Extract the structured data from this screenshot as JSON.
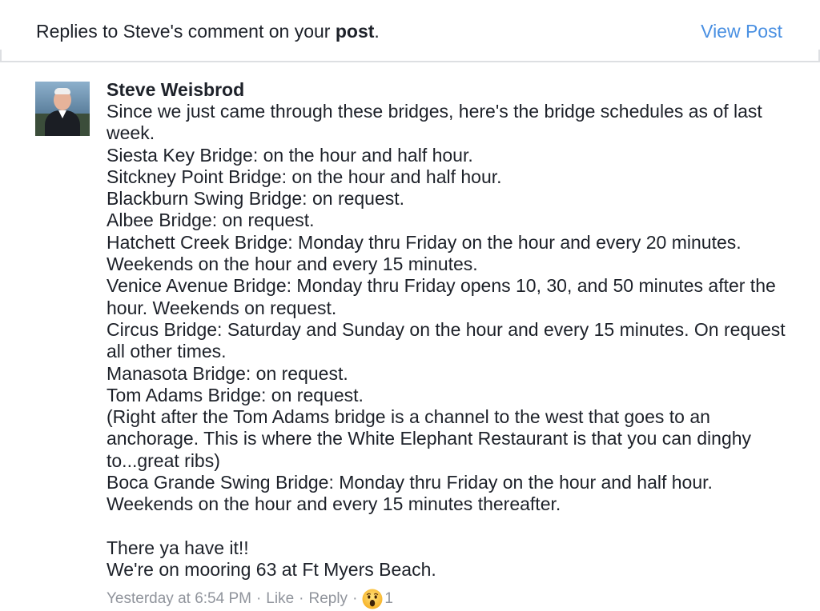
{
  "header": {
    "title_prefix": "Replies to Steve's comment on your ",
    "title_bold": "post",
    "title_suffix": ".",
    "view_post_label": "View Post",
    "accent_color": "#4a90e2"
  },
  "comment": {
    "author": "Steve Weisbrod",
    "avatar_icon": "profile-photo",
    "text": "Since we just came through these bridges, here's the bridge schedules as of last week.\nSiesta Key Bridge: on the hour and half hour.\nSitckney Point Bridge: on the hour and half hour.\nBlackburn Swing Bridge: on request.\nAlbee Bridge: on request.\nHatchett Creek Bridge: Monday thru Friday on the hour and every 20 minutes. Weekends on the hour and every 15 minutes.\nVenice Avenue Bridge: Monday thru Friday opens 10, 30, and 50 minutes after the hour. Weekends on request.\nCircus Bridge: Saturday and Sunday on the hour and every 15 minutes. On request all other times.\nManasota Bridge: on request.\nTom Adams Bridge: on request.\n(Right after the Tom Adams bridge is a channel to the west that goes to an anchorage. This is where the White Elephant Restaurant is that you can dinghy to...great ribs)\nBoca Grande Swing Bridge: Monday thru Friday on the hour and half hour. Weekends on the hour and every 15 minutes thereafter.\n\nThere ya have it!!\nWe're on mooring 63 at Ft Myers Beach.",
    "timestamp": "Yesterday at 6:54 PM",
    "separator": "·",
    "like_label": "Like",
    "reply_label": "Reply",
    "reaction_icon": "wow-emoji",
    "reaction_count": "1"
  }
}
